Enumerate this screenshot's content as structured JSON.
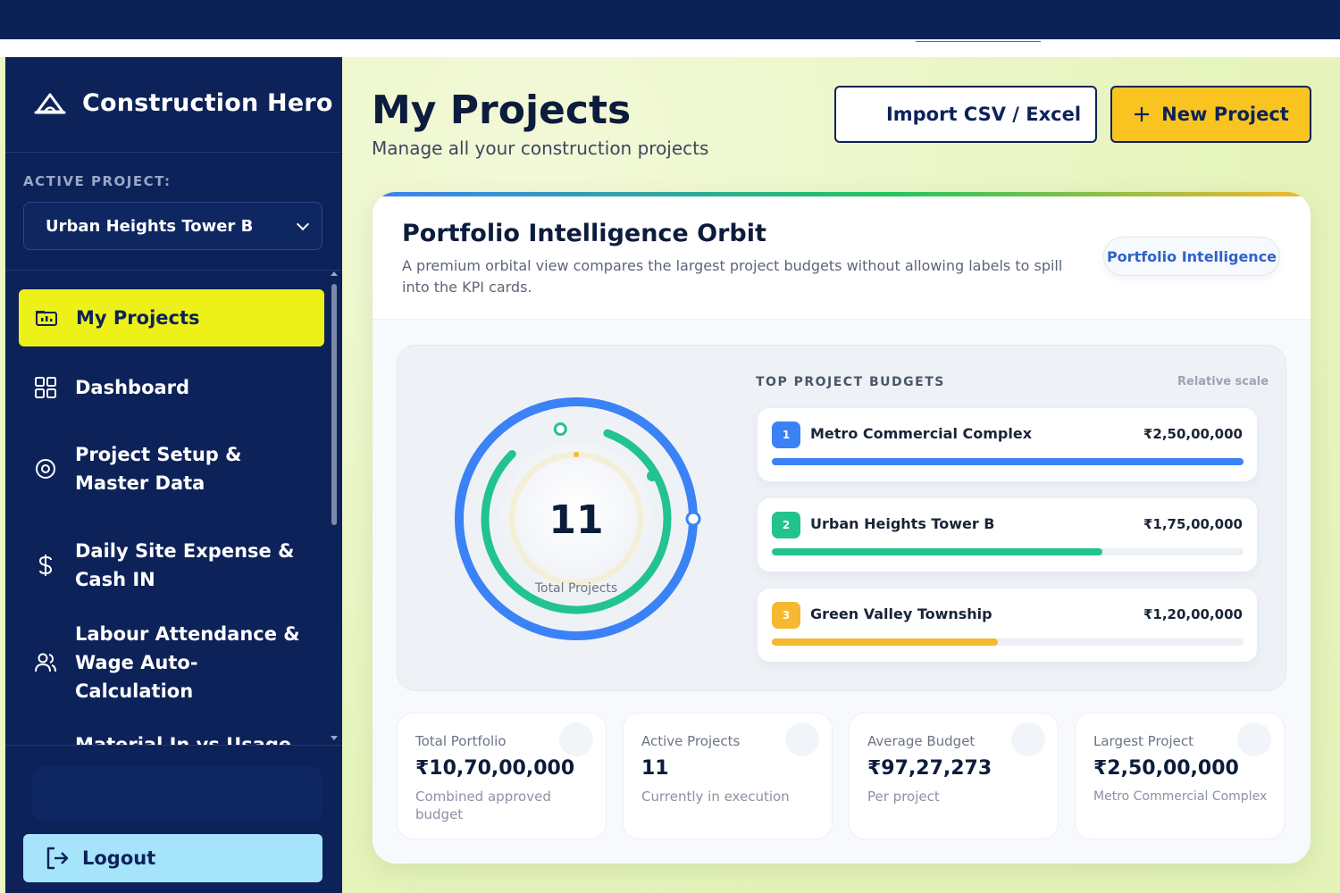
{
  "sidebar": {
    "brand": "Construction Hero",
    "active_project_label": "ACTIVE PROJECT:",
    "active_project": "Urban Heights Tower B",
    "nav": [
      {
        "label": "My Projects",
        "icon": "folder-icon",
        "active": true
      },
      {
        "label": "Dashboard",
        "icon": "grid-icon"
      },
      {
        "label": "Project Setup & Master Data",
        "icon": "gear-icon"
      },
      {
        "label": "Daily Site Expense & Cash IN",
        "icon": "dollar-icon"
      },
      {
        "label": "Labour Attendance & Wage Auto-Calculation",
        "icon": "users-icon"
      },
      {
        "label": "Material In vs Usage",
        "icon": "box-icon"
      }
    ],
    "logout": "Logout"
  },
  "header": {
    "title": "My Projects",
    "subtitle": "Manage all your construction projects",
    "import_label": "Import CSV / Excel",
    "new_label": "New Project"
  },
  "orbit": {
    "title": "Portfolio Intelligence Orbit",
    "description": "A premium orbital view compares the largest project budgets without allowing labels to spill into the KPI cards.",
    "badge": "Portfolio Intelligence",
    "count": "11",
    "count_label": "Total Projects",
    "top_label": "TOP PROJECT BUDGETS",
    "scale_label": "Relative scale",
    "budgets": [
      {
        "rank": "1",
        "name": "Metro Commercial Complex",
        "amount": "₹2,50,00,000",
        "share": 1.0,
        "color": "#3b82f6"
      },
      {
        "rank": "2",
        "name": "Urban Heights Tower B",
        "amount": "₹1,75,00,000",
        "share": 0.7,
        "color": "#22c38e"
      },
      {
        "rank": "3",
        "name": "Green Valley Township",
        "amount": "₹1,20,00,000",
        "share": 0.48,
        "color": "#f5b82e"
      }
    ]
  },
  "kpis": [
    {
      "label": "Total Portfolio",
      "value": "₹10,70,00,000",
      "note": "Combined approved budget"
    },
    {
      "label": "Active Projects",
      "value": "11",
      "note": "Currently in execution"
    },
    {
      "label": "Average Budget",
      "value": "₹97,27,273",
      "note": "Per project"
    },
    {
      "label": "Largest Project",
      "value": "₹2,50,00,000",
      "note": "Metro Commercial Complex"
    }
  ],
  "colors": {
    "navy": "#0c2259",
    "accent_yellow": "#eef117",
    "new_button": "#f9c41f",
    "logout": "#a6e4fb"
  }
}
